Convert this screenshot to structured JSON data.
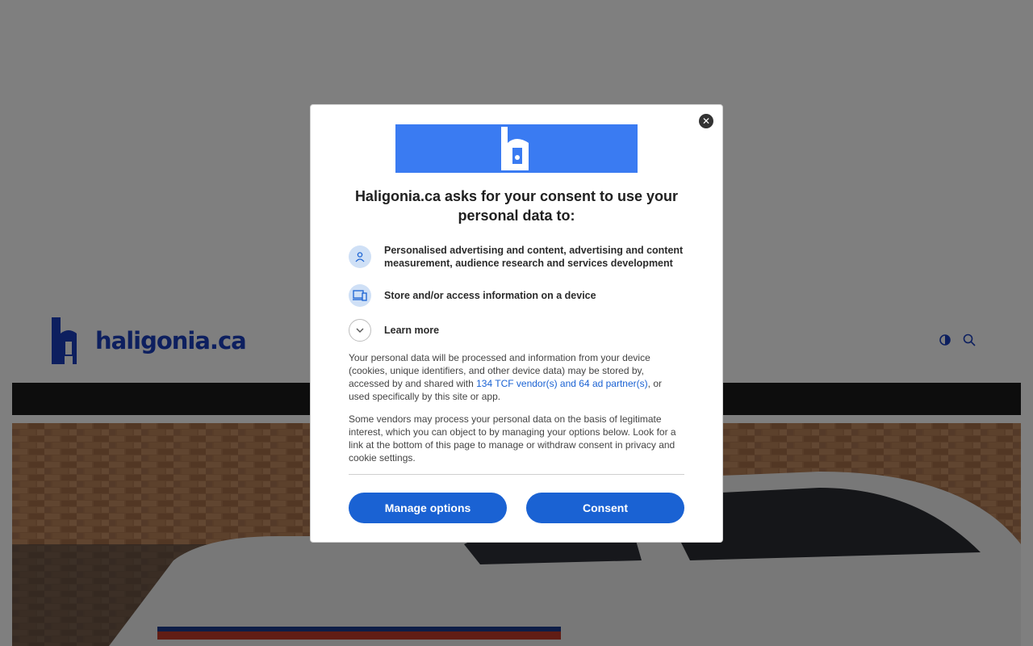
{
  "site": {
    "logo_text": "haligonia.ca",
    "brand_color": "#1a3fbf"
  },
  "header_tools": {
    "theme_toggle_icon": "half-moon-icon",
    "search_icon": "search-icon"
  },
  "dialog": {
    "title": "Haligonia.ca asks for your consent to use your personal data to:",
    "close_icon": "close-icon",
    "purposes": [
      {
        "icon": "person-icon",
        "label": "Personalised advertising and content, advertising and content measurement, audience research and services development"
      },
      {
        "icon": "devices-icon",
        "label": "Store and/or access information on a device"
      }
    ],
    "learn_more": {
      "icon": "chevron-down-icon",
      "label": "Learn more"
    },
    "paragraph1": {
      "before": "Your personal data will be processed and information from your device (cookies, unique identifiers, and other device data) may be stored by, accessed by and shared with ",
      "link": "134 TCF vendor(s) and 64 ad partner(s)",
      "after": ", or used specifically by this site or app."
    },
    "paragraph2": "Some vendors may process your personal data on the basis of legitimate interest, which you can object to by managing your options below. Look for a link at the bottom of this page to manage or withdraw consent in privacy and cookie settings.",
    "manage_button": "Manage options",
    "consent_button": "Consent",
    "accent_color": "#1a62d3"
  }
}
